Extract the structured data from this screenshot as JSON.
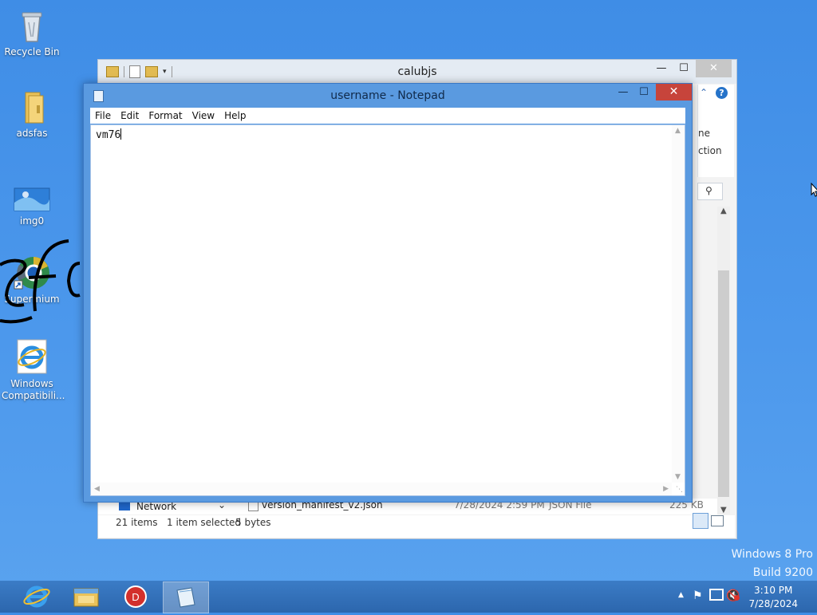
{
  "desktop": {
    "icons": [
      {
        "label": "Recycle Bin"
      },
      {
        "label": "adsfas"
      },
      {
        "label": "img0"
      },
      {
        "label": "Supermium"
      },
      {
        "label": "Windows Compatibili..."
      }
    ],
    "scribble_text": "efa"
  },
  "explorer": {
    "title": "calubjs",
    "partial_labels": {
      "ne": "ne",
      "ction": "ction"
    },
    "nav_item": "Network",
    "file_row": {
      "name": "version_manifest_v2.json",
      "date": "7/28/2024 2:59 PM",
      "type": "JSON File",
      "size": "225 KB"
    },
    "status": {
      "items": "21 items",
      "selected": "1 item selected",
      "size": "5 bytes"
    }
  },
  "notepad": {
    "title": "username - Notepad",
    "menu": [
      "File",
      "Edit",
      "Format",
      "View",
      "Help"
    ],
    "content": "vm76"
  },
  "watermark": {
    "line1": "Windows 8 Pro",
    "line2": "Build 9200"
  },
  "taskbar": {
    "clock_time": "3:10 PM",
    "clock_date": "7/28/2024"
  },
  "colors": {
    "accent": "#3f8de6",
    "taskbar": "#2f6fb9",
    "close": "#c7443b"
  }
}
